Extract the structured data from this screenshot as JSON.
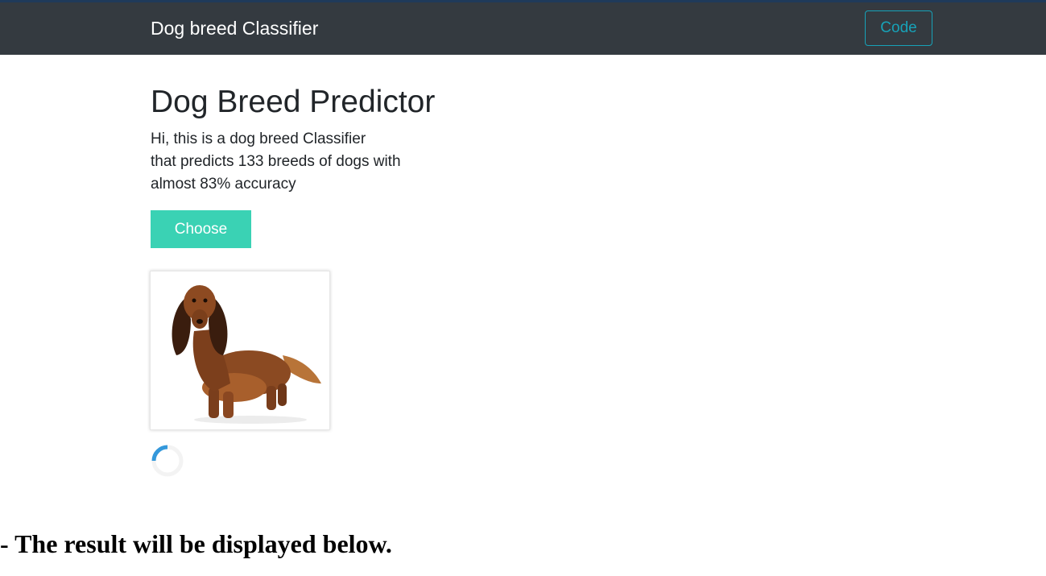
{
  "navbar": {
    "brand": "Dog breed Classifier",
    "code_label": "Code"
  },
  "main": {
    "title": "Dog Breed Predictor",
    "description_lines": [
      "Hi, this is a dog breed Classifier",
      "that predicts 133 breeds of dogs with",
      "almost 83% accuracy"
    ],
    "choose_label": "Choose",
    "uploaded_image_icon": "dog-photo-icon",
    "loading_icon": "spinner-icon"
  },
  "result": {
    "text": "- The result will be displayed below."
  },
  "colors": {
    "navbar_bg": "#343a40",
    "accent_teal": "#3ad2b4",
    "code_outline": "#17a2b8",
    "spinner": "#3498db"
  }
}
